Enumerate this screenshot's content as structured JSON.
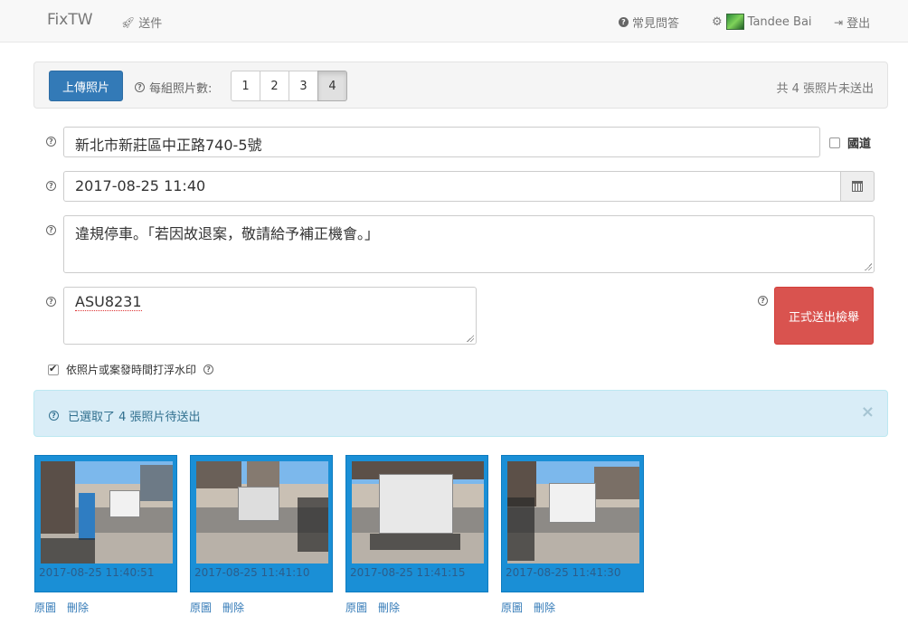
{
  "navbar": {
    "brand": "FixTW",
    "send_label": "送件",
    "faq_label": "常見問答",
    "user_name": "Tandee Bai",
    "logout_label": "登出"
  },
  "toolbar": {
    "upload_label": "上傳照片",
    "group_label": "每組照片數:",
    "group_options": [
      "1",
      "2",
      "3",
      "4"
    ],
    "group_selected": "4",
    "unsent_text": "共 4 張照片未送出"
  },
  "form": {
    "address_value": "新北市新莊區中正路740-5號",
    "highway_label": "國道",
    "highway_checked": false,
    "datetime_value": "2017-08-25 11:40",
    "description_value": "違規停車。「若因故退案，敬請給予補正機會。」",
    "plate_value": "ASU8231",
    "submit_label": "正式送出檢舉",
    "watermark_label": "依照片或案發時間打浮水印",
    "watermark_checked": true
  },
  "alert": {
    "text": "已選取了 4 張照片待送出",
    "close": "×"
  },
  "photos": [
    {
      "timestamp": "2017-08-25 11:40:51",
      "original": "原圖",
      "delete": "刪除"
    },
    {
      "timestamp": "2017-08-25 11:41:10",
      "original": "原圖",
      "delete": "刪除"
    },
    {
      "timestamp": "2017-08-25 11:41:15",
      "original": "原圖",
      "delete": "刪除"
    },
    {
      "timestamp": "2017-08-25 11:41:30",
      "original": "原圖",
      "delete": "刪除"
    }
  ],
  "colors": {
    "primary": "#337ab7",
    "danger": "#d9534f",
    "info_bg": "#d9edf7",
    "thumb_frame": "#1a8fd6"
  }
}
